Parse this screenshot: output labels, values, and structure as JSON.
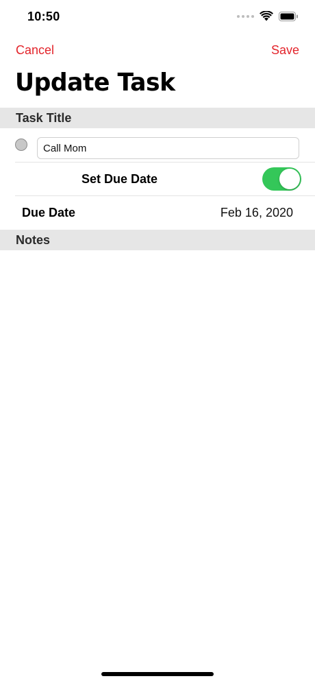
{
  "status_bar": {
    "time": "10:50",
    "icons": [
      "signal-dots-icon",
      "wifi-icon",
      "battery-icon"
    ]
  },
  "nav": {
    "cancel_label": "Cancel",
    "save_label": "Save",
    "accent_color": "#e3242b"
  },
  "page_title": "Update Task",
  "sections": {
    "task_title_header": "Task Title",
    "notes_header": "Notes"
  },
  "task": {
    "title_value": "Call Mom",
    "completed": false
  },
  "due": {
    "set_due_date_label": "Set Due Date",
    "set_due_date_enabled": true,
    "switch_color": "#34c759",
    "due_date_label": "Due Date",
    "due_date_value": "Feb 16, 2020"
  }
}
